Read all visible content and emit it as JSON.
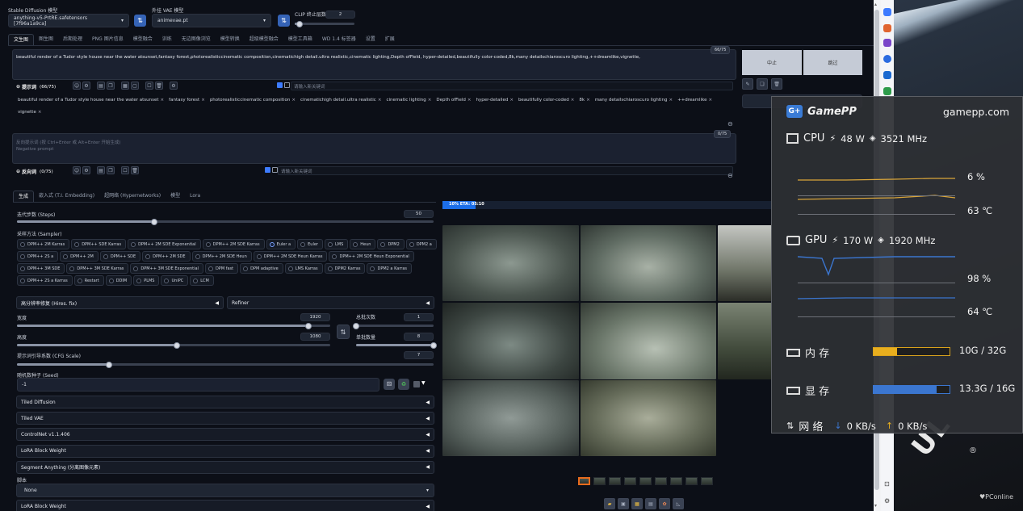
{
  "header": {
    "sd_model_label": "Stable Diffusion 模型",
    "sd_model_value": "anything-v5-PrtRE.safetensors [7f96a1a9ca]",
    "vae_label": "外挂 VAE 模型",
    "vae_value": "animevae.pt",
    "clip_label": "CLIP 终止层数",
    "clip_value": "2"
  },
  "tabs": [
    "文生图",
    "图生图",
    "后期处理",
    "PNG 图片信息",
    "模型融合",
    "训练",
    "无边图像浏览",
    "模型转换",
    "超级模型融合",
    "模型工具箱",
    "WD 1.4 标签器",
    "设置",
    "扩展"
  ],
  "prompt": {
    "text": "beautiful render of a Tudor style house near the water atsunset,fantasy forest,photorealisticcinematic composition,cinematichigh detail.ultra realistic,cinematic lighting,Depth ofField, hyper-detailed,beautifully color-coded,8k,many detailschiaroscuro lighting,++dreamlike,vignette,",
    "token_count": "66/75",
    "label": "提示词",
    "label_count": "(66/75)",
    "keyword_placeholder": "请输入新关键词",
    "tags": [
      "beautiful render of a Tudor style house near the water atsunset",
      "fantasy forest",
      "photorealisticcinematic composition",
      "cinematichigh detail.ultra realistic",
      "cinematic lighting",
      "Depth ofField",
      "hyper-detailed",
      "beautifully color-coded",
      "8k",
      "many detailschiaroscuro lighting",
      "++dreamlike",
      "vignette"
    ]
  },
  "negative": {
    "placeholder_line1": "反向提示词 (按 Ctrl+Enter 或 Alt+Enter 开始生成)",
    "placeholder_line2": "Negative prompt",
    "token_count": "0/75",
    "label": "反向词",
    "label_count": "(0/75)",
    "keyword_placeholder": "请输入新关键词"
  },
  "generate": {
    "interrupt": "中止",
    "skip": "跳过"
  },
  "subtabs": [
    "生成",
    "嵌入式 (T.I. Embedding)",
    "超网络 (Hypernetworks)",
    "模型",
    "Lora"
  ],
  "steps": {
    "label": "迭代步数 (Steps)",
    "value": "50",
    "fraction": 0.33
  },
  "sampler": {
    "label": "采样方法 (Sampler)",
    "selected": "Euler a",
    "options": [
      "DPM++ 2M Karras",
      "DPM++ SDE Karras",
      "DPM++ 2M SDE Exponential",
      "DPM++ 2M SDE Karras",
      "Euler a",
      "Euler",
      "LMS",
      "Heun",
      "DPM2",
      "DPM2 a",
      "DPM++ 2S a",
      "DPM++ 2M",
      "DPM++ SDE",
      "DPM++ 2M SDE",
      "DPM++ 2M SDE Heun",
      "DPM++ 2M SDE Heun Karras",
      "DPM++ 2M SDE Heun Exponential",
      "DPM++ 3M SDE",
      "DPM++ 3M SDE Karras",
      "DPM++ 3M SDE Exponential",
      "DPM fast",
      "DPM adaptive",
      "LMS Karras",
      "DPM2 Karras",
      "DPM2 a Karras",
      "DPM++ 2S a Karras",
      "Restart",
      "DDIM",
      "PLMS",
      "UniPC",
      "LCM"
    ]
  },
  "hires": {
    "label": "高分辨率修复 (Hires. fix)",
    "refiner": "Refiner"
  },
  "width": {
    "label": "宽度",
    "value": "1920",
    "fraction": 0.93
  },
  "height": {
    "label": "高度",
    "value": "1080",
    "fraction": 0.51
  },
  "batch_count": {
    "label": "总批次数",
    "value": "1",
    "fraction": 0.0
  },
  "batch_size": {
    "label": "单批数量",
    "value": "8",
    "fraction": 1.0
  },
  "cfg": {
    "label": "提示词引导系数 (CFG Scale)",
    "value": "7",
    "fraction": 0.22
  },
  "seed": {
    "label": "随机数种子 (Seed)",
    "value": "-1"
  },
  "accordions": [
    "Tiled Diffusion",
    "Tiled VAE",
    "ControlNet v1.1.406",
    "LoRA Block Weight",
    "Segment Anything (分离图像元素)"
  ],
  "script": {
    "label": "脚本",
    "value": "None"
  },
  "accordion_last": "LoRA Block Weight",
  "progress": {
    "text": "10% ETA: 05:10",
    "fraction": 0.1
  },
  "gamepp": {
    "brand": "GamePP",
    "site": "gamepp.com",
    "cpu": {
      "label": "CPU",
      "power": "48 W",
      "clock": "3521 MHz",
      "usage": "6 %",
      "temp": "63 ℃"
    },
    "gpu": {
      "label": "GPU",
      "power": "170 W",
      "clock": "1920 MHz",
      "usage": "98 %",
      "temp": "64 ℃"
    },
    "mem": {
      "label": "内 存",
      "value": "10G / 32G",
      "fraction": 0.3125
    },
    "vram": {
      "label": "显 存",
      "value": "13.3G / 16G",
      "fraction": 0.83
    },
    "net": {
      "label": "网 络",
      "down": "0 KB/s",
      "up": "0 KB/s"
    }
  },
  "watermark": "PConline",
  "colors": {
    "accent": "#3563b6",
    "progress": "#1c6ee8",
    "mem": "#e8ae1e",
    "vram": "#3b76d0"
  }
}
